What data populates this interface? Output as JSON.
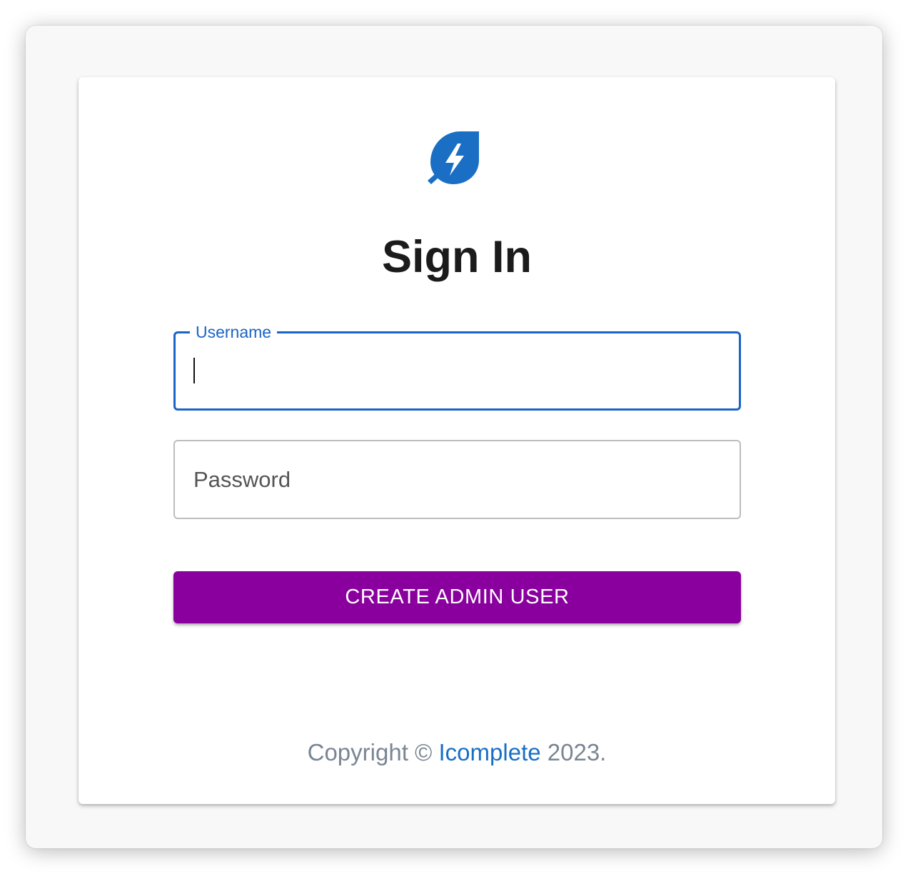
{
  "colors": {
    "primary": "#1a64c7",
    "button": "#8a009e",
    "logo": "#1a6fc4",
    "footer_text": "#7a8593",
    "link": "#1a6fc4"
  },
  "logo": {
    "icon": "lightning-leaf-icon"
  },
  "title": "Sign In",
  "username": {
    "label": "Username",
    "value": ""
  },
  "password": {
    "placeholder": "Password",
    "value": ""
  },
  "submit": {
    "label": "CREATE ADMIN USER"
  },
  "footer": {
    "prefix": "Copyright ©",
    "link_text": "Icomplete",
    "suffix": "2023."
  }
}
